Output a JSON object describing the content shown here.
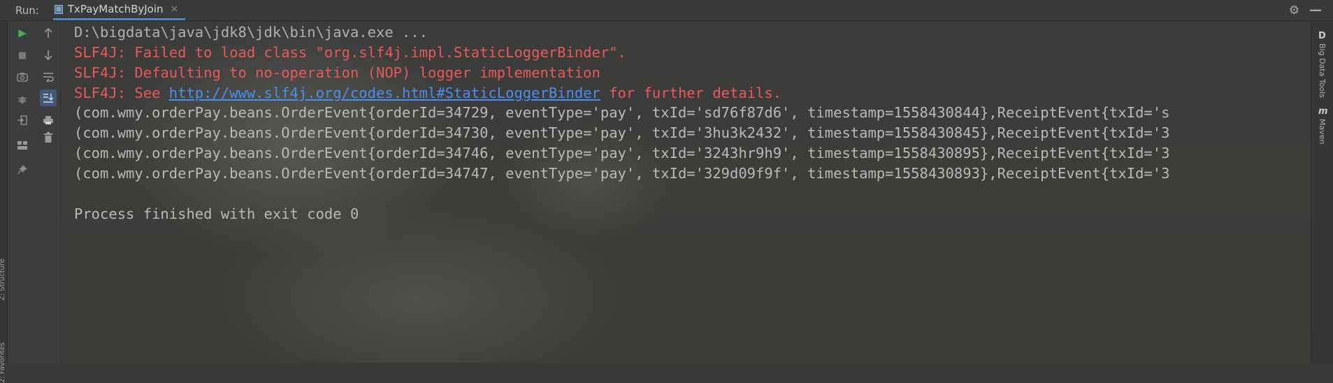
{
  "toolwindow": {
    "run_label": "Run:",
    "tab_title": "TxPayMatchByJoin",
    "tab_close": "×"
  },
  "icons": {
    "run": "run-icon",
    "stop": "stop-icon",
    "camera": "camera-icon",
    "debug": "bug-icon",
    "login": "login-icon",
    "layout": "layout-icon",
    "pin": "pin-icon",
    "up": "arrow-up-icon",
    "down": "arrow-down-icon",
    "wrap": "soft-wrap-icon",
    "scroll_end": "scroll-to-end-icon",
    "print": "print-icon",
    "trash": "trash-icon",
    "settings": "gear-icon",
    "minimize": "minimize-icon"
  },
  "colors": {
    "accent_tab": "#4a88c7",
    "error_text": "#e8595b",
    "link_text": "#4b8ef0",
    "run_green": "#4fa74d"
  },
  "console": {
    "cmd_line": "D:\\bigdata\\java\\jdk8\\jdk\\bin\\java.exe ...",
    "err1": "SLF4J: Failed to load class \"org.slf4j.impl.StaticLoggerBinder\".",
    "err2": "SLF4J: Defaulting to no-operation (NOP) logger implementation",
    "err3_prefix": "SLF4J: See ",
    "err3_link": "http://www.slf4j.org/codes.html#StaticLoggerBinder",
    "err3_suffix": " for further details.",
    "output": [
      "(com.wmy.orderPay.beans.OrderEvent{orderId=34729, eventType='pay', txId='sd76f87d6', timestamp=1558430844},ReceiptEvent{txId='s",
      "(com.wmy.orderPay.beans.OrderEvent{orderId=34730, eventType='pay', txId='3hu3k2432', timestamp=1558430845},ReceiptEvent{txId='3",
      "(com.wmy.orderPay.beans.OrderEvent{orderId=34746, eventType='pay', txId='3243hr9h9', timestamp=1558430895},ReceiptEvent{txId='3",
      "(com.wmy.orderPay.beans.OrderEvent{orderId=34747, eventType='pay', txId='329d09f9f', timestamp=1558430893},ReceiptEvent{txId='3"
    ],
    "exit_line": "Process finished with exit code 0"
  },
  "side_panels": {
    "left_structure": "Z: Structure",
    "left_favorites": "2: Favorites",
    "right_bigdata": "Big Data Tools",
    "right_maven": "Maven",
    "right_bigdata_glyph": "D",
    "right_maven_glyph": "m"
  }
}
